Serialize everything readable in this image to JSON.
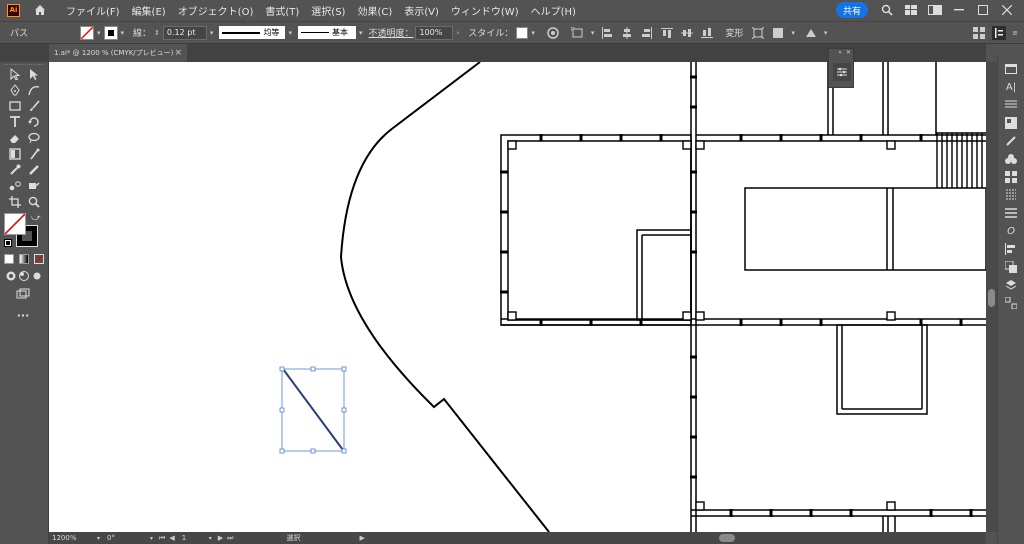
{
  "app": {
    "logo_text": "Ai"
  },
  "menu": {
    "items": [
      "ファイル(F)",
      "編集(E)",
      "オブジェクト(O)",
      "書式(T)",
      "選択(S)",
      "効果(C)",
      "表示(V)",
      "ウィンドウ(W)",
      "ヘルプ(H)"
    ],
    "share_label": "共有"
  },
  "control_bar": {
    "object_type": "パス",
    "stroke_label": "線：",
    "stroke_weight": "0.12 pt",
    "stroke_profile": "均等",
    "brush": "基本",
    "opacity_label": "不透明度：",
    "opacity_value": "100%",
    "style_label": "スタイル：",
    "transform_label": "変形"
  },
  "document": {
    "tab_title": "1.ai* @ 1200 % (CMYK/プレビュー)",
    "close_glyph": "×"
  },
  "status_bar": {
    "zoom": "1200%",
    "rotation": "0°",
    "artboard": "1",
    "tool": "選択"
  },
  "colors": {
    "accent": "#1473e6",
    "selection": "#4f7bd6",
    "ui_bg": "#535353",
    "canvas_bg": "#ffffff"
  }
}
